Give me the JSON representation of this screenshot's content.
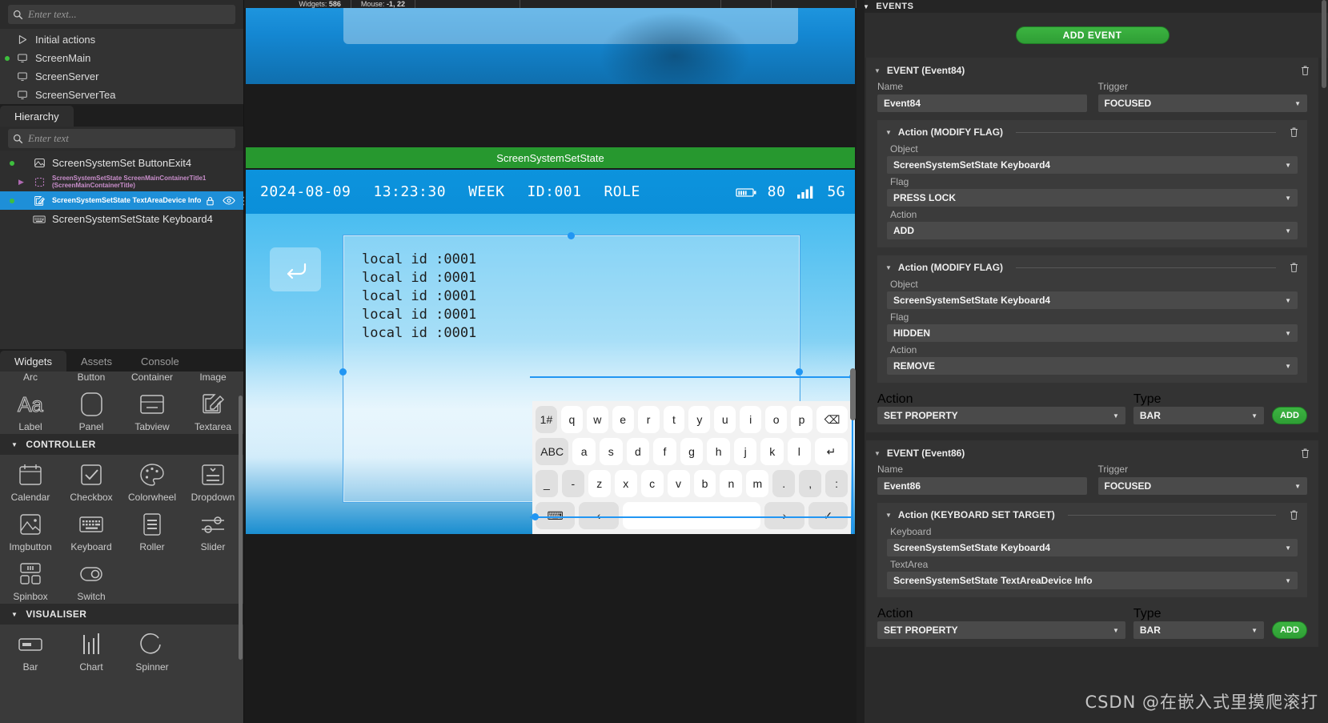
{
  "left": {
    "search": {
      "placeholder": "Enter text...",
      "icon": "search-icon"
    },
    "screens": [
      {
        "label": "Initial actions",
        "icon": "play-triangle-icon",
        "active": false
      },
      {
        "label": "ScreenMain",
        "icon": "monitor-icon",
        "active": true
      },
      {
        "label": "ScreenServer",
        "icon": "monitor-icon",
        "active": false
      },
      {
        "label": "ScreenServerTea",
        "icon": "monitor-icon",
        "active": false
      }
    ],
    "tabs": [
      {
        "label": "Hierarchy",
        "active": true
      }
    ],
    "hierarchy_search": {
      "placeholder": "Enter text",
      "icon": "search-icon"
    },
    "hierarchy": [
      {
        "label": "ScreenSystemSet ButtonExit4",
        "icon": "imgbutton-icon",
        "dot": true,
        "arrow": false,
        "selected": false,
        "small": false
      },
      {
        "label": "ScreenSystemSetState ScreenMainContainerTitle1",
        "label2": "(ScreenMainContainerTitle)",
        "icon": "container-dashed-icon",
        "dot": false,
        "arrow": true,
        "selected": false,
        "small": true
      },
      {
        "label": "ScreenSystemSetState TextAreaDevice Info",
        "icon": "textarea-icon",
        "dot": true,
        "arrow": false,
        "selected": true,
        "small": true,
        "row_icons": [
          "lock-icon",
          "eye-icon",
          "kebab-menu-icon"
        ]
      },
      {
        "label": "ScreenSystemSetState Keyboard4",
        "icon": "keyboard-icon",
        "dot": false,
        "arrow": false,
        "selected": false,
        "small": false
      }
    ],
    "panel_tabs": [
      {
        "label": "Widgets",
        "active": true
      },
      {
        "label": "Assets",
        "active": false
      },
      {
        "label": "Console",
        "active": false
      }
    ],
    "widgets_cut_labels": [
      "Arc",
      "Button",
      "Container",
      "Image"
    ],
    "widget_groups": [
      {
        "header": null,
        "items": [
          {
            "label": "Label",
            "icon": "label-aa-icon"
          },
          {
            "label": "Panel",
            "icon": "panel-rounded-icon"
          },
          {
            "label": "Tabview",
            "icon": "tabview-icon"
          },
          {
            "label": "Textarea",
            "icon": "textarea-pencil-icon"
          }
        ]
      },
      {
        "header": "CONTROLLER",
        "items": [
          {
            "label": "Calendar",
            "icon": "calendar-icon"
          },
          {
            "label": "Checkbox",
            "icon": "checkbox-icon"
          },
          {
            "label": "Colorwheel",
            "icon": "palette-icon"
          },
          {
            "label": "Dropdown",
            "icon": "dropdown-icon"
          },
          {
            "label": "Imgbutton",
            "icon": "imgbutton-icon"
          },
          {
            "label": "Keyboard",
            "icon": "keyboard-icon"
          },
          {
            "label": "Roller",
            "icon": "roller-icon"
          },
          {
            "label": "Slider",
            "icon": "slider-icon"
          },
          {
            "label": "Spinbox",
            "icon": "spinbox-icon"
          },
          {
            "label": "Switch",
            "icon": "switch-icon"
          }
        ]
      },
      {
        "header": "VISUALISER",
        "items": [
          {
            "label": "Bar",
            "icon": "bar-icon"
          },
          {
            "label": "Chart",
            "icon": "chart-icon"
          },
          {
            "label": "Spinner",
            "icon": "spinner-icon"
          }
        ]
      }
    ]
  },
  "center": {
    "status": {
      "widgets_label": "Widgets:",
      "widgets_value": "586",
      "mouse_label": "Mouse:",
      "mouse_value": "-1, 22"
    },
    "screen_title": "ScreenSystemSetState",
    "device_statusbar": {
      "date": "2024-08-09",
      "time": "13:23:30",
      "week": "WEEK",
      "id": "ID:001",
      "role": "ROLE",
      "battery": "80",
      "network": "5G",
      "battery_icon": "battery-icon",
      "signal_icon": "signal-bars-icon"
    },
    "back_button_icon": "return-arrow-icon",
    "textarea_lines": [
      "local id :0001",
      "local id :0001",
      "local id :0001",
      "local id :0001",
      "local id :0001"
    ],
    "keyboard": {
      "row1": [
        "1#",
        "q",
        "w",
        "e",
        "r",
        "t",
        "y",
        "u",
        "i",
        "o",
        "p",
        "⌫"
      ],
      "row2": [
        "ABC",
        "a",
        "s",
        "d",
        "f",
        "g",
        "h",
        "j",
        "k",
        "l",
        "↵"
      ],
      "row3": [
        "_",
        "-",
        "z",
        "x",
        "c",
        "v",
        "b",
        "n",
        "m",
        ".",
        ",",
        ":"
      ],
      "row4": [
        "⌨",
        "‹",
        "",
        "›",
        "✓"
      ]
    }
  },
  "right": {
    "section_header": "EVENTS",
    "add_event_label": "ADD EVENT",
    "events": [
      {
        "title": "EVENT (Event84)",
        "name_label": "Name",
        "name_value": "Event84",
        "trigger_label": "Trigger",
        "trigger_value": "FOCUSED",
        "actions": [
          {
            "title": "Action (MODIFY FLAG)",
            "fields": [
              {
                "label": "Object",
                "value": "ScreenSystemSetState Keyboard4"
              },
              {
                "label": "Flag",
                "value": "PRESS LOCK"
              },
              {
                "label": "Action",
                "value": "ADD"
              }
            ]
          },
          {
            "title": "Action (MODIFY FLAG)",
            "fields": [
              {
                "label": "Object",
                "value": "ScreenSystemSetState Keyboard4"
              },
              {
                "label": "Flag",
                "value": "HIDDEN"
              },
              {
                "label": "Action",
                "value": "REMOVE"
              }
            ]
          }
        ],
        "footer": {
          "action_label": "Action",
          "action_value": "SET PROPERTY",
          "type_label": "Type",
          "type_value": "BAR",
          "add_label": "ADD"
        }
      },
      {
        "title": "EVENT (Event86)",
        "name_label": "Name",
        "name_value": "Event86",
        "trigger_label": "Trigger",
        "trigger_value": "FOCUSED",
        "actions": [
          {
            "title": "Action (KEYBOARD SET TARGET)",
            "fields": [
              {
                "label": "Keyboard",
                "value": "ScreenSystemSetState Keyboard4"
              },
              {
                "label": "TextArea",
                "value": "ScreenSystemSetState TextAreaDevice Info"
              }
            ]
          }
        ],
        "footer": {
          "action_label": "Action",
          "action_value": "SET PROPERTY",
          "type_label": "Type",
          "type_value": "BAR",
          "add_label": "ADD"
        }
      }
    ]
  },
  "watermark": "CSDN @在嵌入式里摸爬滚打",
  "colors": {
    "accent_green": "#2f9e35",
    "selection_blue": "#1e8fd8",
    "title_green": "#27982f",
    "device_blue": "#0c93dd"
  }
}
